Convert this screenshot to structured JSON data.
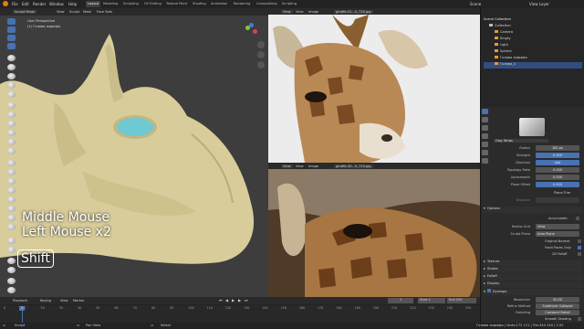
{
  "menu": [
    "File",
    "Edit",
    "Render",
    "Window",
    "Help"
  ],
  "workspaces": [
    "Layout",
    "Modeling",
    "Sculpting",
    "UV Editing",
    "Texture Paint",
    "Shading",
    "Animation",
    "Rendering",
    "Compositing",
    "Scripting"
  ],
  "active_workspace": "Layout",
  "scene_label": "Scene",
  "view_layer_label": "View Layer",
  "viewport": {
    "mode": "Sculpt Mode",
    "menus": [
      "View",
      "Sculpt",
      "Mask",
      "Face Sets"
    ],
    "view_name": "User Perspective",
    "object_name": "(1) Голова жирафа",
    "overlay_lines": [
      "Middle Mouse",
      "Left Mouse x2"
    ],
    "key": "Shift"
  },
  "image_editor_1": {
    "menus": [
      "View",
      "View",
      "Image"
    ],
    "image_name": "giraffe-21...0_720.jpg"
  },
  "image_editor_2": {
    "menus": [
      "View",
      "View",
      "Image"
    ],
    "image_name": "giraffe-30...0_720.jpg"
  },
  "outliner": {
    "title": "Scene Collection",
    "rows": [
      {
        "label": "Collection",
        "selected": false
      },
      {
        "label": "Camera",
        "selected": false
      },
      {
        "label": "Empty",
        "selected": false
      },
      {
        "label": "Light",
        "selected": false
      },
      {
        "label": "Sphere",
        "selected": false
      },
      {
        "label": "Голова жирафа",
        "selected": false
      },
      {
        "label": "Голова_2",
        "selected": true
      }
    ]
  },
  "properties": {
    "brush_name": "Clay Strips",
    "rows": [
      {
        "label": "Radius",
        "value": "100 px",
        "blue": false
      },
      {
        "label": "Strength",
        "value": "0.500",
        "blue": true
      },
      {
        "label": "Direction",
        "value": "Add",
        "blue": true
      },
      {
        "label": "Topology Rake",
        "value": "0.000",
        "blue": false
      },
      {
        "label": "Autosmooth",
        "value": "0.000",
        "blue": false
      },
      {
        "label": "Plane Offset",
        "value": "0.000",
        "blue": true
      }
    ],
    "plane_trim": "Plane Trim",
    "distance_label": "Distance",
    "options_section": "Options",
    "accumulate": "Accumulate",
    "option_rows": [
      {
        "label": "Radius Unit",
        "value": "View"
      },
      {
        "label": "Sculpt Plane",
        "value": "Area Plane"
      }
    ],
    "checkboxes": [
      "Original Normal",
      "Front Faces Only",
      "2D Falloff"
    ],
    "collapsed_sections": [
      "Texture",
      "Stroke",
      "Falloff",
      "Display",
      "Dyntopo"
    ],
    "dyntopo_rows": [
      {
        "label": "Resolution",
        "value": "50.00"
      },
      {
        "label": "Refine Method",
        "value": "Subdivide Collapse"
      },
      {
        "label": "Detailing",
        "value": "Constant Detail"
      }
    ],
    "smooth_shading": "Smooth Shading"
  },
  "timeline": {
    "menus": [
      "Playback",
      "Keying",
      "View",
      "Marker"
    ],
    "current_frame": "1",
    "start_label": "Start",
    "start_value": "1",
    "end_label": "End",
    "end_value": "250",
    "ticks": [
      "0",
      "10",
      "20",
      "30",
      "40",
      "50",
      "60",
      "70",
      "80",
      "90",
      "100",
      "110",
      "120",
      "130",
      "140",
      "150",
      "160",
      "170",
      "180",
      "190",
      "200",
      "210",
      "220",
      "230",
      "240",
      "250"
    ]
  },
  "status": {
    "left": "Sculpt",
    "middle": "Pan View",
    "right_action": "Select",
    "stats": "Голова жирафа | Verts:172 121 | Tris:344 240 | 2.92"
  }
}
